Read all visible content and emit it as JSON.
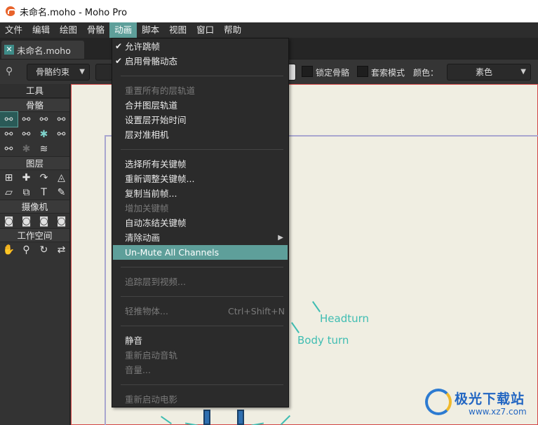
{
  "window": {
    "title": "未命名.moho - Moho Pro"
  },
  "menubar": [
    "文件",
    "编辑",
    "绘图",
    "骨骼",
    "动画",
    "脚本",
    "视图",
    "窗口",
    "帮助"
  ],
  "tab": {
    "label": "未命名.moho"
  },
  "options": {
    "bone_constraint": "骨骼约束",
    "lock_bone": "锁定骨骼",
    "lasso_mode": "套索模式",
    "color_label": "颜色：",
    "color_value": "素色"
  },
  "toolbox": {
    "header": "工具",
    "bones": "骨骼",
    "layers": "图层",
    "camera": "摄像机",
    "workspace": "工作空间"
  },
  "canvas": {
    "labels": [
      "Headturn",
      "Body turn"
    ]
  },
  "animation_menu": {
    "items": [
      {
        "label": "允许跳帧",
        "checked": true
      },
      {
        "label": "启用骨骼动态",
        "checked": true
      },
      {
        "label": "重置所有的层轨道",
        "disabled": true
      },
      {
        "label": "合并图层轨道"
      },
      {
        "label": "设置层开始时间"
      },
      {
        "label": "层对准相机"
      },
      {
        "label": "选择所有关键帧"
      },
      {
        "label": "重新调整关键帧..."
      },
      {
        "label": "复制当前帧..."
      },
      {
        "label": "增加关键帧",
        "disabled": true
      },
      {
        "label": "自动冻结关键帧"
      },
      {
        "label": "清除动画",
        "submenu": true
      },
      {
        "label": "Un-Mute All Channels",
        "highlighted": true
      },
      {
        "label": "追踪层到视频...",
        "disabled": true
      },
      {
        "label": "轻推物体...",
        "disabled": true,
        "shortcut": "Ctrl+Shift+N"
      },
      {
        "label": "静音"
      },
      {
        "label": "重新启动音轨",
        "disabled": true
      },
      {
        "label": "音量...",
        "disabled": true
      },
      {
        "label": "重新启动电影",
        "disabled": true
      }
    ]
  },
  "watermark": {
    "title": "极光下载站",
    "url": "www.xz7.com"
  }
}
